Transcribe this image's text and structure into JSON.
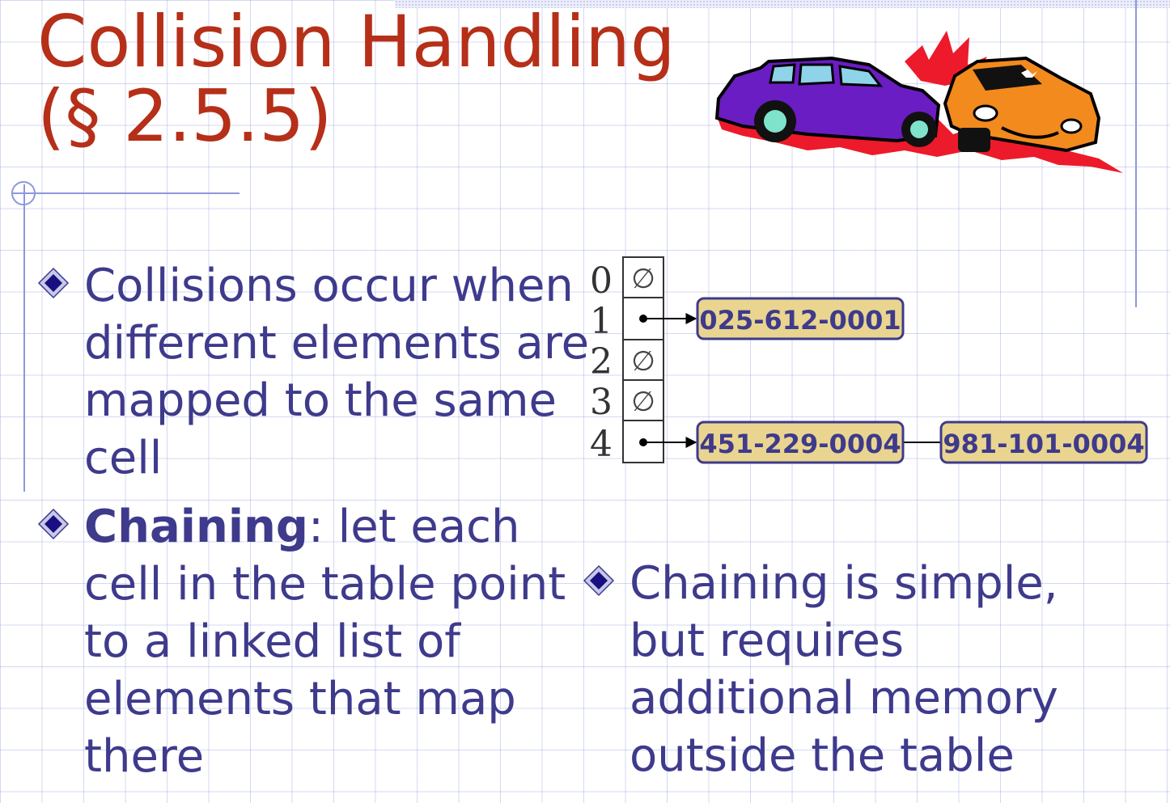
{
  "slide": {
    "title_line1": "Collision Handling",
    "title_line2": "(§ 2.5.5)"
  },
  "bullets": [
    {
      "lines": [
        "Collisions occur when",
        "different elements are",
        "mapped to the same",
        "cell"
      ]
    },
    {
      "bold_term": "Chaining",
      "first_line_rest": ": let each",
      "lines": [
        "cell in the table point",
        "to a linked list of",
        "elements that map",
        "there"
      ]
    },
    {
      "lines": [
        "Chaining is simple,",
        "but requires",
        "additional memory",
        "outside the table"
      ]
    }
  ],
  "diagram": {
    "indices": [
      "0",
      "1",
      "2",
      "3",
      "4"
    ],
    "empty_symbol": "∅",
    "cells": [
      "empty",
      "pointer",
      "empty",
      "empty",
      "pointer"
    ],
    "nodes": {
      "row1": [
        "025-612-0001"
      ],
      "row4": [
        "451-229-0004",
        "981-101-0004"
      ]
    }
  },
  "clipart": {
    "name": "car-crash-clipart"
  },
  "colors": {
    "title": "#b62f18",
    "body_text": "#3e3a8c",
    "node_fill": "#e9d58f",
    "node_border": "#3e3a8c",
    "diamond": "#1a0f80"
  }
}
